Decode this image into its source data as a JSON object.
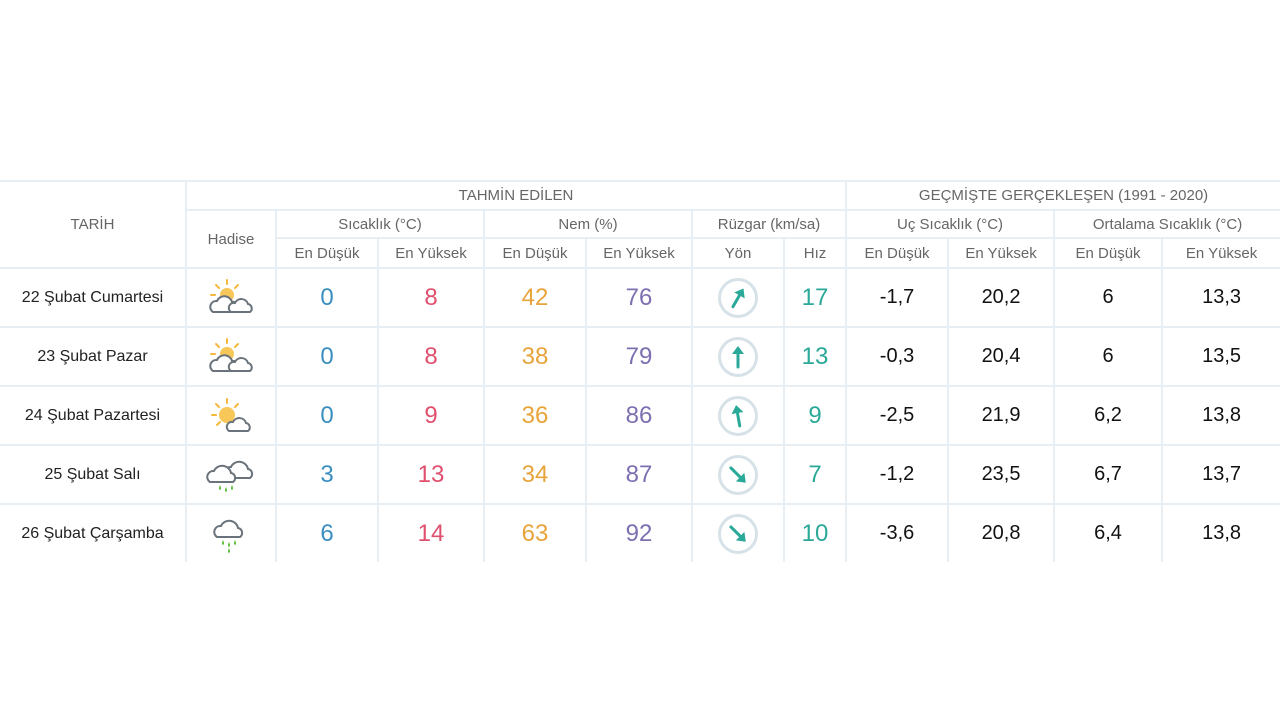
{
  "header": {
    "tarih": "TARİH",
    "hadise": "Hadise",
    "forecast": "TAHMİN EDİLEN",
    "history": "GEÇMİŞTE GERÇEKLEŞEN (1991 - 2020)",
    "temp": "Sıcaklık (°C)",
    "humidity": "Nem (%)",
    "wind": "Rüzgar (km/sa)",
    "extreme": "Uç Sıcaklık (°C)",
    "average": "Ortalama Sıcaklık (°C)",
    "low": "En Düşük",
    "high": "En Yüksek",
    "dir": "Yön",
    "speed": "Hız"
  },
  "rows": [
    {
      "date": "22 Şubat Cumartesi",
      "icon": "partly-cloudy-icon",
      "tmin": "0",
      "tmax": "8",
      "hmin": "42",
      "hmax": "76",
      "wind_deg": 210,
      "wind_speed": "17",
      "x_min": "-1,7",
      "x_max": "20,2",
      "a_min": "6",
      "a_max": "13,3"
    },
    {
      "date": "23 Şubat Pazar",
      "icon": "partly-cloudy-icon",
      "tmin": "0",
      "tmax": "8",
      "hmin": "38",
      "hmax": "79",
      "wind_deg": 180,
      "wind_speed": "13",
      "x_min": "-0,3",
      "x_max": "20,4",
      "a_min": "6",
      "a_max": "13,5"
    },
    {
      "date": "24 Şubat Pazartesi",
      "icon": "mostly-sunny-icon",
      "tmin": "0",
      "tmax": "9",
      "hmin": "36",
      "hmax": "86",
      "wind_deg": 170,
      "wind_speed": "9",
      "x_min": "-2,5",
      "x_max": "21,9",
      "a_min": "6,2",
      "a_max": "13,8"
    },
    {
      "date": "25 Şubat Salı",
      "icon": "cloudy-rain-icon",
      "tmin": "3",
      "tmax": "13",
      "hmin": "34",
      "hmax": "87",
      "wind_deg": 315,
      "wind_speed": "7",
      "x_min": "-1,2",
      "x_max": "23,5",
      "a_min": "6,7",
      "a_max": "13,7"
    },
    {
      "date": "26 Şubat Çarşamba",
      "icon": "rain-icon",
      "tmin": "6",
      "tmax": "14",
      "hmin": "63",
      "hmax": "92",
      "wind_deg": 315,
      "wind_speed": "10",
      "x_min": "-3,6",
      "x_max": "20,8",
      "a_min": "6,4",
      "a_max": "13,8"
    }
  ],
  "colors": {
    "low": "#3b8fc0",
    "high": "#e0506e",
    "hum_low": "#e8a43a",
    "hum_high": "#7d6fb0",
    "wind": "#2aa898"
  }
}
